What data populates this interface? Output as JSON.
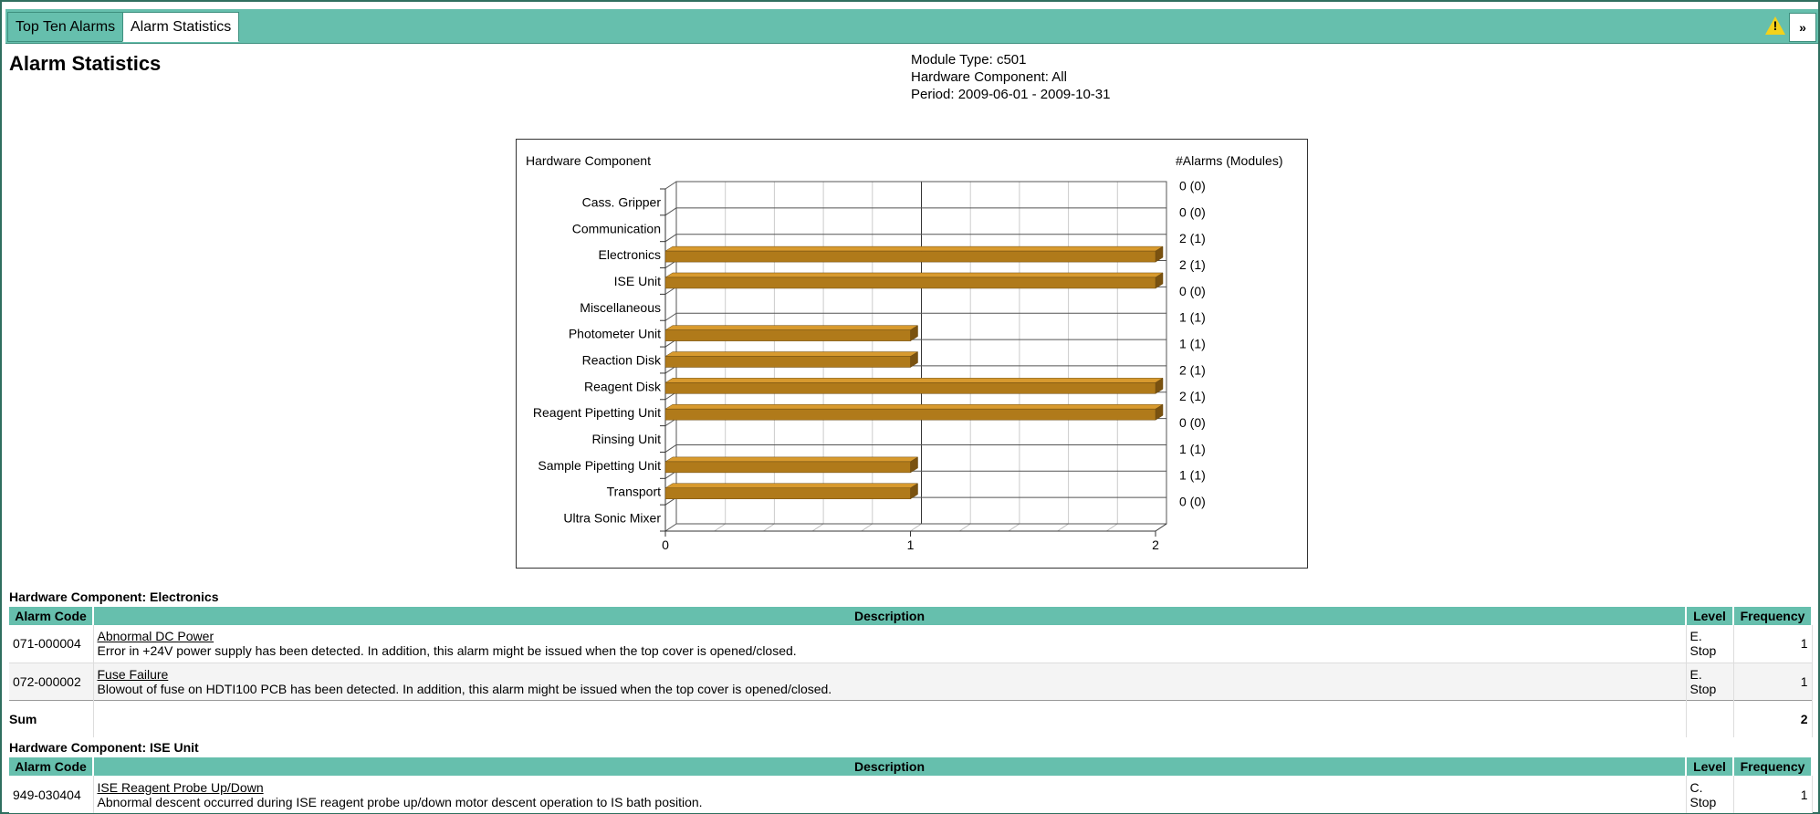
{
  "tabs": [
    {
      "label": "Top Ten Alarms",
      "active": false
    },
    {
      "label": "Alarm Statistics",
      "active": true
    }
  ],
  "toolbar": {
    "warning_icon": "warning-triangle-icon",
    "more_label": "»"
  },
  "page": {
    "title": "Alarm Statistics"
  },
  "meta": {
    "module_type": "Module Type: c501",
    "hardware_component": "Hardware Component: All",
    "period": "Period: 2009-06-01 - 2009-10-31"
  },
  "chart_data": {
    "type": "bar",
    "orientation": "horizontal",
    "style": "3d",
    "ylabel": "Hardware Component",
    "right_label": "#Alarms (Modules)",
    "categories": [
      "Cass. Gripper",
      "Communication",
      "Electronics",
      "ISE Unit",
      "Miscellaneous",
      "Photometer Unit",
      "Reaction Disk",
      "Reagent Disk",
      "Reagent Pipetting Unit",
      "Rinsing Unit",
      "Sample Pipetting Unit",
      "Transport",
      "Ultra Sonic Mixer"
    ],
    "values": [
      0,
      0,
      2,
      2,
      0,
      1,
      1,
      2,
      2,
      0,
      1,
      1,
      0
    ],
    "modules": [
      0,
      0,
      1,
      1,
      0,
      1,
      1,
      1,
      1,
      0,
      1,
      1,
      0
    ],
    "value_labels": [
      "0 (0)",
      "0 (0)",
      "2 (1)",
      "2 (1)",
      "0 (0)",
      "1 (1)",
      "1 (1)",
      "2 (1)",
      "2 (1)",
      "0 (0)",
      "1 (1)",
      "1 (1)",
      "0 (0)"
    ],
    "xlim": [
      0,
      2
    ],
    "xticks": [
      "0",
      "1",
      "2"
    ],
    "bar_color": "#b07a1a",
    "grid": true
  },
  "sections": [
    {
      "title": "Hardware Component: Electronics",
      "headers": {
        "code": "Alarm Code",
        "desc": "Description",
        "level": "Level",
        "freq": "Frequency"
      },
      "rows": [
        {
          "code": "071-000004",
          "name": "Abnormal DC Power",
          "detail": "Error in +24V power supply has been detected. In addition, this alarm might be issued when the top cover is opened/closed.",
          "level": "E. Stop",
          "freq": "1"
        },
        {
          "code": "072-000002",
          "name": "Fuse Failure",
          "detail": "Blowout of fuse on HDTI100 PCB has been detected. In addition, this alarm might be issued when the top cover is opened/closed.",
          "level": "E. Stop",
          "freq": "1"
        }
      ],
      "sum_label": "Sum",
      "sum_value": "2"
    },
    {
      "title": "Hardware Component: ISE Unit",
      "headers": {
        "code": "Alarm Code",
        "desc": "Description",
        "level": "Level",
        "freq": "Frequency"
      },
      "rows": [
        {
          "code": "949-030404",
          "name": "ISE Reagent Probe Up/Down",
          "detail": "Abnormal descent occurred during ISE reagent probe up/down motor descent operation to IS bath position.",
          "level": "C. Stop",
          "freq": "1"
        }
      ]
    }
  ]
}
